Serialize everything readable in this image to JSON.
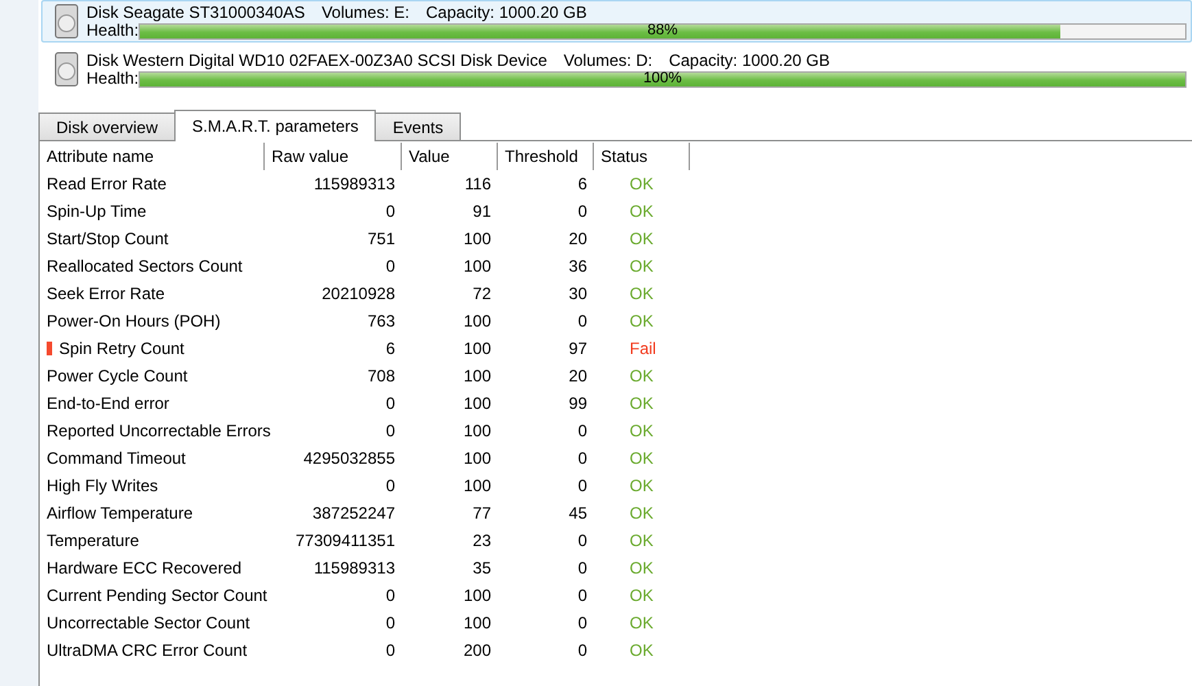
{
  "disks": [
    {
      "name": "Disk Seagate ST31000340AS",
      "volumes": "Volumes: E:",
      "capacity": "Capacity: 1000.20 GB",
      "health_label": "Health:",
      "level": 0.88,
      "reading": "88%",
      "selected": true
    },
    {
      "name": "Disk Western Digital WD10 02FAEX-00Z3A0 SCSI Disk Device",
      "volumes": "Volumes: D:",
      "capacity": "Capacity: 1000.20 GB",
      "health_label": "Health:",
      "level": 1.0,
      "reading": "100%",
      "selected": false
    }
  ],
  "tabs": [
    {
      "label": "Disk overview",
      "selected": false
    },
    {
      "label": "S.M.A.R.T. parameters",
      "selected": true
    },
    {
      "label": "Events",
      "selected": false
    }
  ],
  "table": {
    "columns": [
      "Attribute name",
      "Raw value",
      "Value",
      "Threshold",
      "Status"
    ],
    "rows": [
      {
        "name": "Read Error Rate",
        "raw": "115989313",
        "value": "116",
        "threshold": "6",
        "status": "OK",
        "failed": false
      },
      {
        "name": "Spin-Up Time",
        "raw": "0",
        "value": "91",
        "threshold": "0",
        "status": "OK",
        "failed": false
      },
      {
        "name": "Start/Stop Count",
        "raw": "751",
        "value": "100",
        "threshold": "20",
        "status": "OK",
        "failed": false
      },
      {
        "name": "Reallocated Sectors Count",
        "raw": "0",
        "value": "100",
        "threshold": "36",
        "status": "OK",
        "failed": false
      },
      {
        "name": "Seek Error Rate",
        "raw": "20210928",
        "value": "72",
        "threshold": "30",
        "status": "OK",
        "failed": false
      },
      {
        "name": "Power-On Hours (POH)",
        "raw": "763",
        "value": "100",
        "threshold": "0",
        "status": "OK",
        "failed": false
      },
      {
        "name": "Spin Retry Count",
        "raw": "6",
        "value": "100",
        "threshold": "97",
        "status": "Fail",
        "failed": true
      },
      {
        "name": "Power Cycle Count",
        "raw": "708",
        "value": "100",
        "threshold": "20",
        "status": "OK",
        "failed": false
      },
      {
        "name": "End-to-End error",
        "raw": "0",
        "value": "100",
        "threshold": "99",
        "status": "OK",
        "failed": false
      },
      {
        "name": "Reported Uncorrectable Errors",
        "raw": "0",
        "value": "100",
        "threshold": "0",
        "status": "OK",
        "failed": false
      },
      {
        "name": "Command Timeout",
        "raw": "4295032855",
        "value": "100",
        "threshold": "0",
        "status": "OK",
        "failed": false
      },
      {
        "name": "High Fly Writes",
        "raw": "0",
        "value": "100",
        "threshold": "0",
        "status": "OK",
        "failed": false
      },
      {
        "name": "Airflow Temperature",
        "raw": "387252247",
        "value": "77",
        "threshold": "45",
        "status": "OK",
        "failed": false
      },
      {
        "name": "Temperature",
        "raw": "77309411351",
        "value": "23",
        "threshold": "0",
        "status": "OK",
        "failed": false
      },
      {
        "name": "Hardware ECC Recovered",
        "raw": "115989313",
        "value": "35",
        "threshold": "0",
        "status": "OK",
        "failed": false
      },
      {
        "name": "Current Pending Sector Count",
        "raw": "0",
        "value": "100",
        "threshold": "0",
        "status": "OK",
        "failed": false
      },
      {
        "name": "Uncorrectable Sector Count",
        "raw": "0",
        "value": "100",
        "threshold": "0",
        "status": "OK",
        "failed": false
      },
      {
        "name": "UltraDMA CRC Error Count",
        "raw": "0",
        "value": "200",
        "threshold": "0",
        "status": "OK",
        "failed": false
      }
    ]
  }
}
